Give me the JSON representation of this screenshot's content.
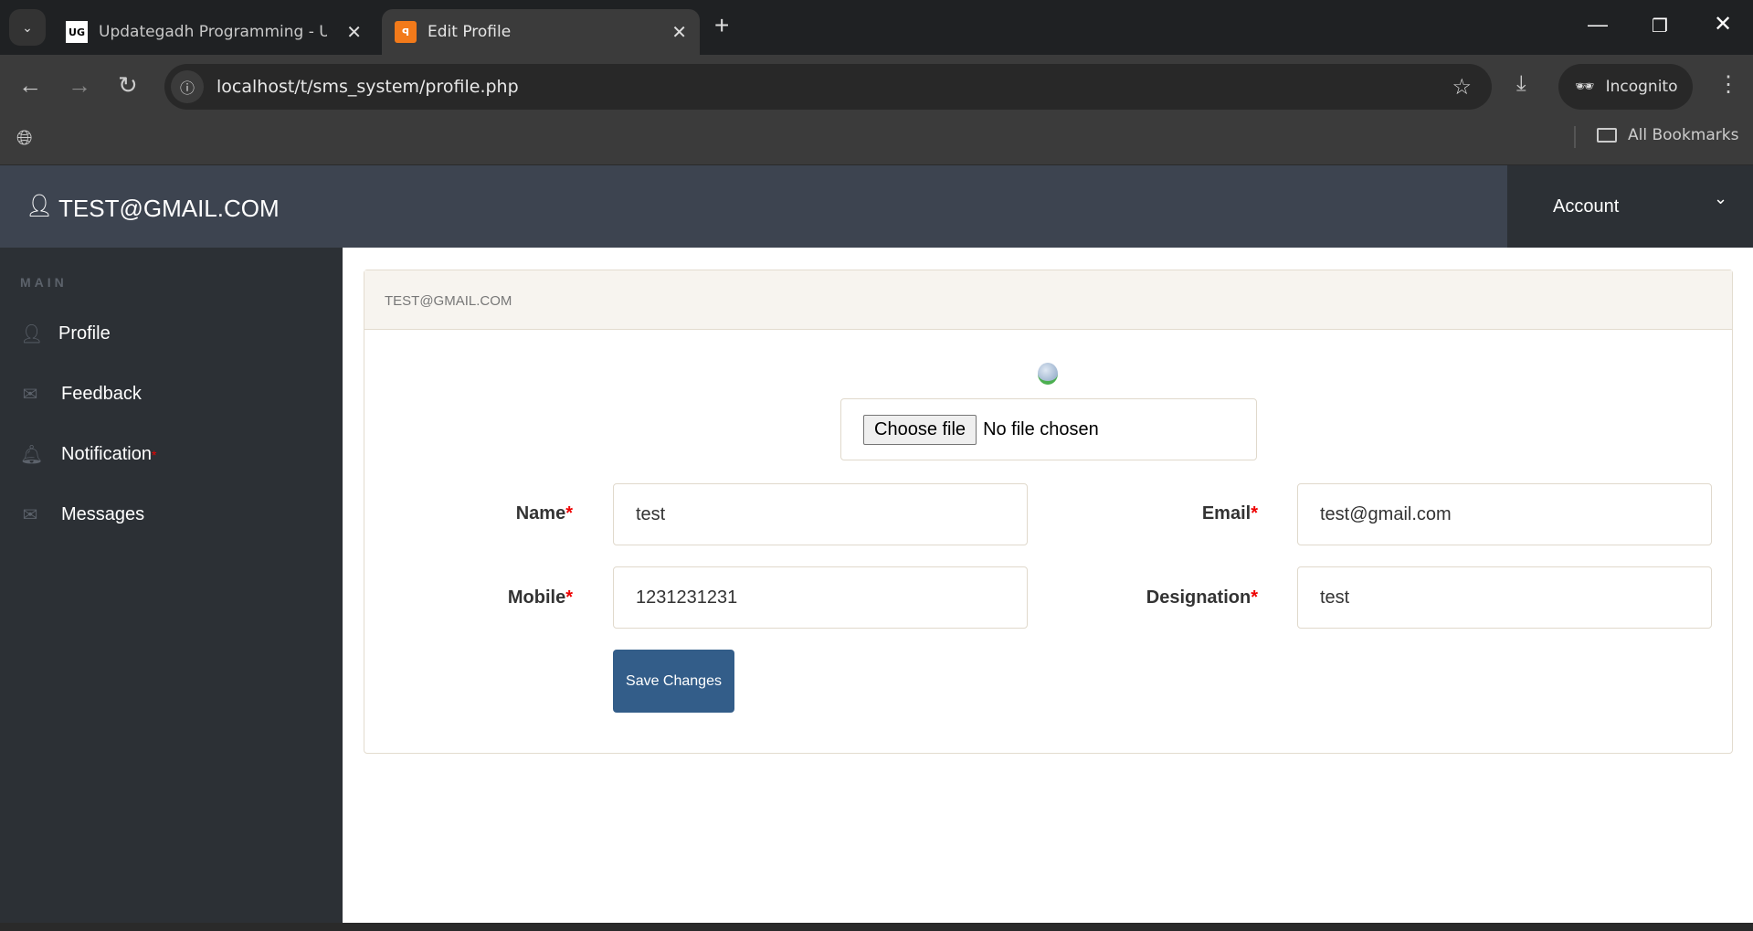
{
  "browser": {
    "tabs": [
      {
        "title": "Updategadh Programming - Up",
        "favicon": "UG"
      },
      {
        "title": "Edit Profile",
        "favicon": "xampp"
      }
    ],
    "url": "localhost/t/sms_system/profile.php",
    "incognito_label": "Incognito",
    "bookmarks_label": "All Bookmarks"
  },
  "header": {
    "user": "TEST@GMAIL.COM",
    "account_label": "Account"
  },
  "sidebar": {
    "section": "MAIN",
    "items": [
      {
        "label": "Profile"
      },
      {
        "label": "Feedback"
      },
      {
        "label": "Notification",
        "badge": "*"
      },
      {
        "label": "Messages"
      }
    ]
  },
  "card": {
    "title": "TEST@GMAIL.COM",
    "file": {
      "button": "Choose file",
      "status": "No file chosen"
    },
    "fields": {
      "name": {
        "label": "Name",
        "value": "test"
      },
      "email": {
        "label": "Email",
        "value": "test@gmail.com"
      },
      "mobile": {
        "label": "Mobile",
        "value": "1231231231"
      },
      "designation": {
        "label": "Designation",
        "value": "test"
      }
    },
    "required_mark": "*",
    "save_label": "Save Changes"
  }
}
